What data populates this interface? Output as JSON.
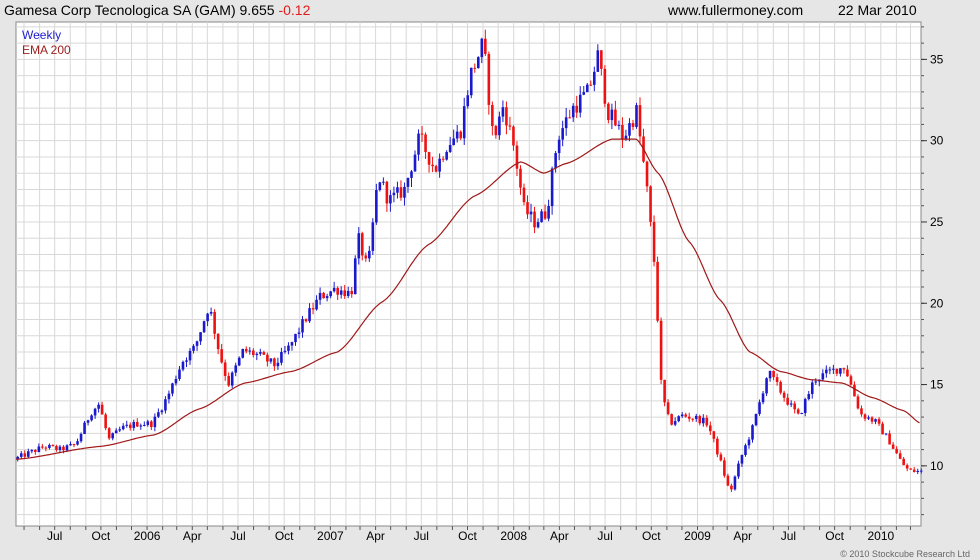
{
  "header": {
    "name": "Gamesa Corp Tecnologica SA (GAM)",
    "price": "9.655",
    "change": "-0.12",
    "source": "www.fullermoney.com",
    "date": "22 Mar 2010"
  },
  "legend": {
    "weekly": "Weekly",
    "ema": "EMA 200"
  },
  "copyright": "© 2010 Stockcube Research Ltd",
  "colors": {
    "up": "#1a1acc",
    "down": "#ee1111",
    "ema": "#a01818",
    "grid": "#d8d8d8",
    "bg": "#ffffff",
    "frame": "#e6e6e6"
  },
  "chart_data": {
    "type": "candlestick",
    "frequency": "Weekly",
    "ylim": [
      6.3,
      37.3
    ],
    "yticks": [
      10,
      15,
      20,
      25,
      30,
      35
    ],
    "xticks": [
      "Jul",
      "Oct",
      "2006",
      "Apr",
      "Jul",
      "Oct",
      "2007",
      "Apr",
      "Jul",
      "Oct",
      "2008",
      "Apr",
      "Jul",
      "Oct",
      "2009",
      "Apr",
      "Jul",
      "Oct",
      "2010"
    ],
    "grid": true,
    "y_axis_side": "right",
    "price_path": [
      [
        "2005-04-15",
        10.4
      ],
      [
        "2005-05-15",
        10.8
      ],
      [
        "2005-06-15",
        11.2
      ],
      [
        "2005-07-15",
        11.0
      ],
      [
        "2005-08-15",
        11.3
      ],
      [
        "2005-09-15",
        13.3
      ],
      [
        "2005-10-01",
        13.8
      ],
      [
        "2005-10-20",
        11.6
      ],
      [
        "2005-11-15",
        12.3
      ],
      [
        "2005-12-15",
        12.6
      ],
      [
        "2006-01-15",
        12.6
      ],
      [
        "2006-02-15",
        14.3
      ],
      [
        "2006-03-15",
        16.4
      ],
      [
        "2006-04-10",
        17.3
      ],
      [
        "2006-05-08",
        19.9
      ],
      [
        "2006-05-28",
        17.0
      ],
      [
        "2006-06-15",
        15.0
      ],
      [
        "2006-07-15",
        17.1
      ],
      [
        "2006-08-15",
        16.8
      ],
      [
        "2006-09-15",
        16.2
      ],
      [
        "2006-10-15",
        17.3
      ],
      [
        "2006-11-15",
        19.0
      ],
      [
        "2006-12-15",
        20.4
      ],
      [
        "2007-01-15",
        20.9
      ],
      [
        "2007-02-15",
        20.6
      ],
      [
        "2007-03-01",
        24.0
      ],
      [
        "2007-03-20",
        22.0
      ],
      [
        "2007-04-10",
        27.9
      ],
      [
        "2007-05-01",
        26.3
      ],
      [
        "2007-06-01",
        27.0
      ],
      [
        "2007-07-01",
        30.2
      ],
      [
        "2007-08-01",
        28.2
      ],
      [
        "2007-08-25",
        29.8
      ],
      [
        "2007-09-20",
        30.5
      ],
      [
        "2007-10-10",
        34.0
      ],
      [
        "2007-11-05",
        36.0
      ],
      [
        "2007-11-25",
        30.0
      ],
      [
        "2007-12-15",
        32.2
      ],
      [
        "2008-01-05",
        29.6
      ],
      [
        "2008-01-25",
        25.8
      ],
      [
        "2008-02-15",
        25.0
      ],
      [
        "2008-03-10",
        25.6
      ],
      [
        "2008-04-01",
        30.2
      ],
      [
        "2008-05-01",
        32.0
      ],
      [
        "2008-06-01",
        33.0
      ],
      [
        "2008-06-20",
        35.2
      ],
      [
        "2008-07-10",
        31.8
      ],
      [
        "2008-08-10",
        30.2
      ],
      [
        "2008-09-05",
        31.8
      ],
      [
        "2008-09-25",
        27.2
      ],
      [
        "2008-10-12",
        22.0
      ],
      [
        "2008-10-25",
        14.5
      ],
      [
        "2008-11-10",
        12.6
      ],
      [
        "2008-12-05",
        13.1
      ],
      [
        "2009-01-05",
        12.9
      ],
      [
        "2009-01-25",
        12.6
      ],
      [
        "2009-02-20",
        10.2
      ],
      [
        "2009-03-10",
        8.3
      ],
      [
        "2009-04-01",
        10.5
      ],
      [
        "2009-04-25",
        12.4
      ],
      [
        "2009-05-25",
        15.8
      ],
      [
        "2009-06-25",
        14.3
      ],
      [
        "2009-07-25",
        13.0
      ],
      [
        "2009-08-25",
        15.3
      ],
      [
        "2009-09-25",
        15.8
      ],
      [
        "2009-10-25",
        16.1
      ],
      [
        "2009-11-25",
        13.2
      ],
      [
        "2009-12-25",
        12.7
      ],
      [
        "2010-01-20",
        11.6
      ],
      [
        "2010-02-15",
        10.2
      ],
      [
        "2010-03-01",
        9.7
      ],
      [
        "2010-03-22",
        9.655
      ]
    ],
    "ema200_path": [
      [
        "2005-04-15",
        10.4
      ],
      [
        "2005-10-01",
        11.2
      ],
      [
        "2006-01-15",
        11.9
      ],
      [
        "2006-04-15",
        13.5
      ],
      [
        "2006-07-15",
        15.1
      ],
      [
        "2006-10-15",
        15.8
      ],
      [
        "2007-01-15",
        17.0
      ],
      [
        "2007-04-15",
        20.1
      ],
      [
        "2007-07-15",
        23.6
      ],
      [
        "2007-10-15",
        26.6
      ],
      [
        "2008-01-15",
        28.7
      ],
      [
        "2008-03-01",
        28.0
      ],
      [
        "2008-04-15",
        28.6
      ],
      [
        "2008-07-15",
        30.1
      ],
      [
        "2008-09-01",
        30.1
      ],
      [
        "2008-10-15",
        28.0
      ],
      [
        "2008-12-15",
        23.8
      ],
      [
        "2009-02-15",
        20.2
      ],
      [
        "2009-04-15",
        17.0
      ],
      [
        "2009-06-15",
        15.8
      ],
      [
        "2009-08-15",
        15.3
      ],
      [
        "2009-10-15",
        15.1
      ],
      [
        "2009-12-15",
        14.2
      ],
      [
        "2010-02-15",
        13.4
      ],
      [
        "2010-03-22",
        12.6
      ]
    ]
  }
}
